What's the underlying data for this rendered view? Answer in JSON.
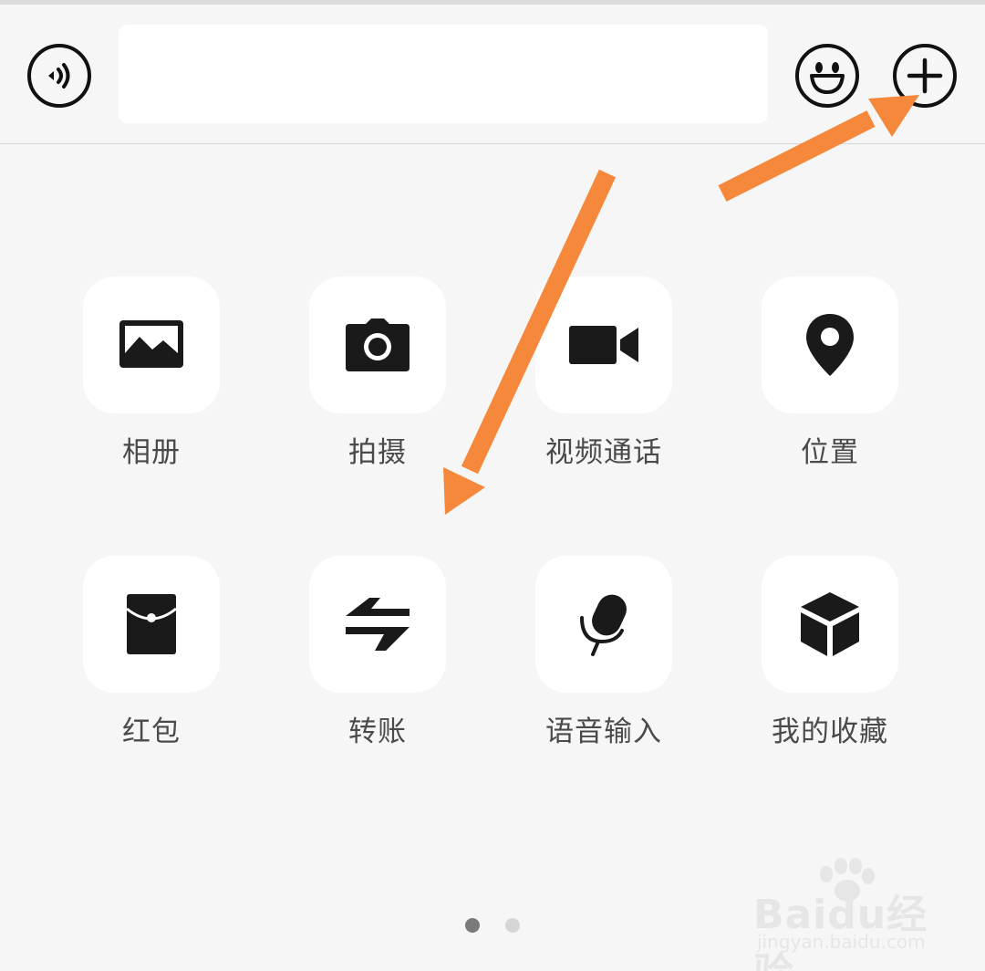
{
  "input_bar": {
    "voice_icon": "voice-wave-icon",
    "text_value": "",
    "emoji_icon": "smiley-face-icon",
    "plus_icon": "plus-icon"
  },
  "grid": {
    "row1": [
      {
        "icon": "photo-icon",
        "label": "相册"
      },
      {
        "icon": "camera-icon",
        "label": "拍摄"
      },
      {
        "icon": "video-camera-icon",
        "label": "视频通话"
      },
      {
        "icon": "location-pin-icon",
        "label": "位置"
      }
    ],
    "row2": [
      {
        "icon": "red-packet-icon",
        "label": "红包"
      },
      {
        "icon": "transfer-icon",
        "label": "转账"
      },
      {
        "icon": "microphone-icon",
        "label": "语音输入"
      },
      {
        "icon": "cube-icon",
        "label": "我的收藏"
      }
    ]
  },
  "pager": {
    "pages": 2,
    "current": 1
  },
  "annotations": {
    "arrow_color": "#f5883a"
  },
  "watermark": {
    "brand": "Baidu经验",
    "url": "jingyan.baidu.com"
  }
}
